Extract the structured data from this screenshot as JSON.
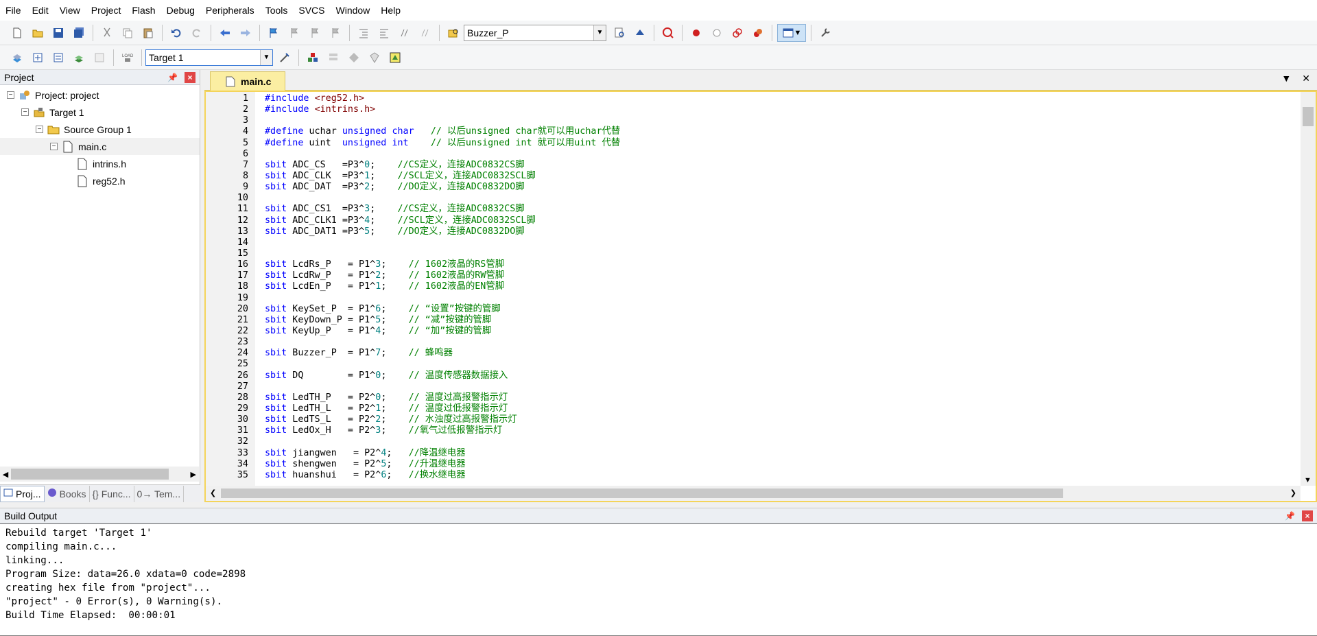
{
  "menu": [
    "File",
    "Edit",
    "View",
    "Project",
    "Flash",
    "Debug",
    "Peripherals",
    "Tools",
    "SVCS",
    "Window",
    "Help"
  ],
  "toolbar": {
    "find_combo": "Buzzer_P",
    "target_combo": "Target 1"
  },
  "project_pane": {
    "title": "Project",
    "tree": [
      {
        "label": "Project: project",
        "level": 0,
        "icon": "project-icon"
      },
      {
        "label": "Target 1",
        "level": 1,
        "icon": "target-icon"
      },
      {
        "label": "Source Group 1",
        "level": 2,
        "icon": "folder-icon"
      },
      {
        "label": "main.c",
        "level": 3,
        "icon": "file-icon",
        "selected": true
      },
      {
        "label": "intrins.h",
        "level": 4,
        "icon": "file-icon"
      },
      {
        "label": "reg52.h",
        "level": 4,
        "icon": "file-icon"
      }
    ],
    "bottom_tabs": [
      "Proj...",
      "Books",
      "{} Func...",
      "0→ Tem..."
    ]
  },
  "editor": {
    "active_tab": "main.c",
    "lines": [
      "#include <reg52.h>",
      "#include <intrins.h>",
      "",
      "#define uchar unsigned char   // 以后unsigned char就可以用uchar代替",
      "#define uint  unsigned int    // 以后unsigned int 就可以用uint 代替",
      "",
      "sbit ADC_CS   =P3^0;    //CS定义，连接ADC0832CS脚",
      "sbit ADC_CLK  =P3^1;    //SCL定义，连接ADC0832SCL脚",
      "sbit ADC_DAT  =P3^2;    //DO定义，连接ADC0832DO脚",
      "",
      "sbit ADC_CS1  =P3^3;    //CS定义，连接ADC0832CS脚",
      "sbit ADC_CLK1 =P3^4;    //SCL定义，连接ADC0832SCL脚",
      "sbit ADC_DAT1 =P3^5;    //DO定义，连接ADC0832DO脚",
      "",
      "",
      "sbit LcdRs_P   = P1^3;    // 1602液晶的RS管脚",
      "sbit LcdRw_P   = P1^2;    // 1602液晶的RW管脚",
      "sbit LcdEn_P   = P1^1;    // 1602液晶的EN管脚",
      "",
      "sbit KeySet_P  = P1^6;    // “设置”按键的管脚",
      "sbit KeyDown_P = P1^5;    // “减”按键的管脚",
      "sbit KeyUp_P   = P1^4;    // “加”按键的管脚",
      "",
      "sbit Buzzer_P  = P1^7;    // 蜂鸣器",
      "",
      "sbit DQ        = P1^0;    // 温度传感器数据接入",
      "",
      "sbit LedTH_P   = P2^0;    // 温度过高报警指示灯",
      "sbit LedTH_L   = P2^1;    // 温度过低报警指示灯",
      "sbit LedTS_L   = P2^2;    // 水浊度过高报警指示灯",
      "sbit LedOx_H   = P2^3;    //氧气过低报警指示灯",
      "",
      "sbit jiangwen   = P2^4;   //降温继电器",
      "sbit shengwen   = P2^5;   //升温继电器",
      "sbit huanshui   = P2^6;   //换水继电器"
    ]
  },
  "build_output": {
    "title": "Build Output",
    "lines": [
      "Rebuild target 'Target 1'",
      "compiling main.c...",
      "linking...",
      "Program Size: data=26.0 xdata=0 code=2898",
      "creating hex file from \"project\"...",
      "\"project\" - 0 Error(s), 0 Warning(s).",
      "Build Time Elapsed:  00:00:01"
    ]
  }
}
